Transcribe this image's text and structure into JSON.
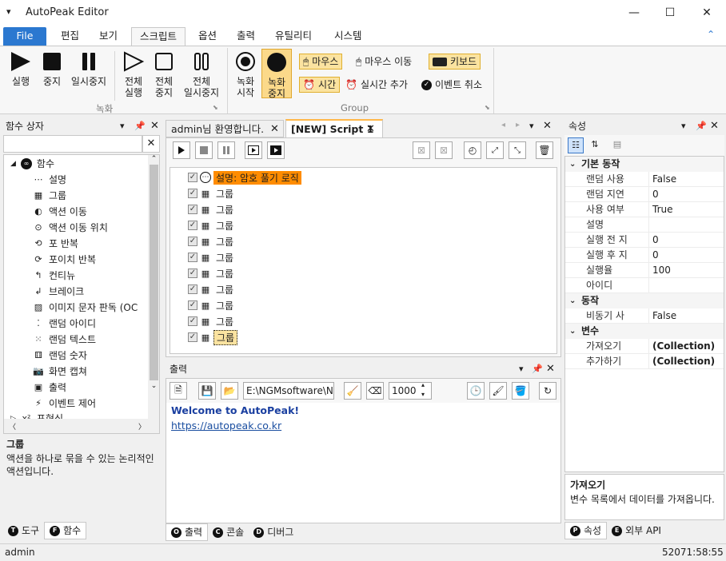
{
  "window": {
    "title": "AutoPeak Editor",
    "minimize": "—",
    "maximize": "☐",
    "close": "✕",
    "system_menu": "▾"
  },
  "menubar": {
    "items": [
      "File",
      "편집",
      "보기",
      "스크립트",
      "옵션",
      "출력",
      "유틸리티",
      "시스템"
    ],
    "active": "스크립트",
    "collapse": "⌃"
  },
  "ribbon": {
    "record_group": {
      "label": "녹화",
      "buttons": [
        {
          "label1": "실행",
          "label2": ""
        },
        {
          "label1": "중지",
          "label2": ""
        },
        {
          "label1": "일시중지",
          "label2": ""
        },
        {
          "label1": "전체",
          "label2": "실행"
        },
        {
          "label1": "전체",
          "label2": "중지"
        },
        {
          "label1": "전체",
          "label2": "일시중지"
        }
      ]
    },
    "group_group": {
      "label": "Group",
      "buttons": [
        {
          "label1": "녹화",
          "label2": "시작"
        },
        {
          "label1": "녹화",
          "label2": "중지"
        }
      ],
      "options": {
        "mouse": "마우스",
        "mouse_move": "마우스 이동",
        "keyboard": "키보드",
        "time": "시간",
        "realtime_add": "실시간 추가",
        "event_cancel": "이벤트 취소"
      }
    }
  },
  "function_box": {
    "title": "함수 상자",
    "search_value": "",
    "clear": "✕",
    "root": "함수",
    "items": [
      "설명",
      "그룹",
      "액션 이동",
      "액션 이동 위치",
      "포 반복",
      "포이치 반복",
      "컨티뉴",
      "브레이크",
      "이미지 문자 판독 (OC",
      "랜덤 아이디",
      "랜덤 텍스트",
      "랜덤 숫자",
      "화면 캡쳐",
      "출력",
      "이벤트 제어"
    ],
    "next_root": "표현식",
    "desc_title": "그룹",
    "desc_text": "액션을 하나로 묶을 수 있는 논리적인 액션입니다.",
    "tabs": [
      {
        "icon": "T",
        "label": "도구"
      },
      {
        "icon": "F",
        "label": "함수"
      }
    ]
  },
  "editor": {
    "tabs": [
      {
        "label": "admin님 환영합니다."
      },
      {
        "label": "[NEW] Script 1"
      }
    ],
    "rows": [
      {
        "check": "✓",
        "label": "설명: 암호 풀기 로직",
        "type": "comment"
      },
      {
        "check": "✓",
        "label": "그룹",
        "type": "group"
      },
      {
        "check": "✓",
        "label": "그룹",
        "type": "group"
      },
      {
        "check": "✓",
        "label": "그룹",
        "type": "group"
      },
      {
        "check": "✓",
        "label": "그룹",
        "type": "group"
      },
      {
        "check": "✓",
        "label": "그룹",
        "type": "group"
      },
      {
        "check": "✓",
        "label": "그룹",
        "type": "group"
      },
      {
        "check": "✓",
        "label": "그룹",
        "type": "group"
      },
      {
        "check": "✓",
        "label": "그룹",
        "type": "group"
      },
      {
        "check": "✓",
        "label": "그룹",
        "type": "group"
      },
      {
        "check": "✓",
        "label": "그룹",
        "type": "group-selected"
      }
    ]
  },
  "output": {
    "title": "출력",
    "path": "E:\\NGMsoftware\\NG",
    "count": "1000",
    "welcome": "Welcome to AutoPeak!",
    "link": "https://autopeak.co.kr",
    "tabs": [
      {
        "icon": "O",
        "label": "출력"
      },
      {
        "icon": "C",
        "label": "콘솔"
      },
      {
        "icon": "D",
        "label": "디버그"
      }
    ]
  },
  "properties": {
    "title": "속성",
    "categories": [
      {
        "name": "기본 동작",
        "rows": [
          {
            "k": "랜덤 사용",
            "v": "False"
          },
          {
            "k": "랜덤 지연",
            "v": "0"
          },
          {
            "k": "사용 여부",
            "v": "True"
          },
          {
            "k": "설명",
            "v": ""
          },
          {
            "k": "실행 전 지",
            "v": "0"
          },
          {
            "k": "실행 후 지",
            "v": "0"
          },
          {
            "k": "실행율",
            "v": "100"
          },
          {
            "k": "아이디",
            "v": ""
          }
        ]
      },
      {
        "name": "동작",
        "rows": [
          {
            "k": "비동기 사",
            "v": "False"
          }
        ]
      },
      {
        "name": "변수",
        "rows": [
          {
            "k": "가져오기",
            "v": "(Collection)",
            "bold": true
          },
          {
            "k": "추가하기",
            "v": "(Collection)",
            "bold": true
          }
        ]
      }
    ],
    "desc_title": "가져오기",
    "desc_text": "변수 목록에서 데이터를 가져옵니다.",
    "tabs": [
      {
        "icon": "P",
        "label": "속성"
      },
      {
        "icon": "E",
        "label": "외부 API"
      }
    ]
  },
  "status": {
    "user": "admin",
    "time": "52071:58:55"
  },
  "colors": {
    "file_blue": "#2b78d0",
    "highlight_orange": "#ff8c00",
    "chip_yellow": "#fbe3a0",
    "link_blue": "#1a4ea0"
  }
}
